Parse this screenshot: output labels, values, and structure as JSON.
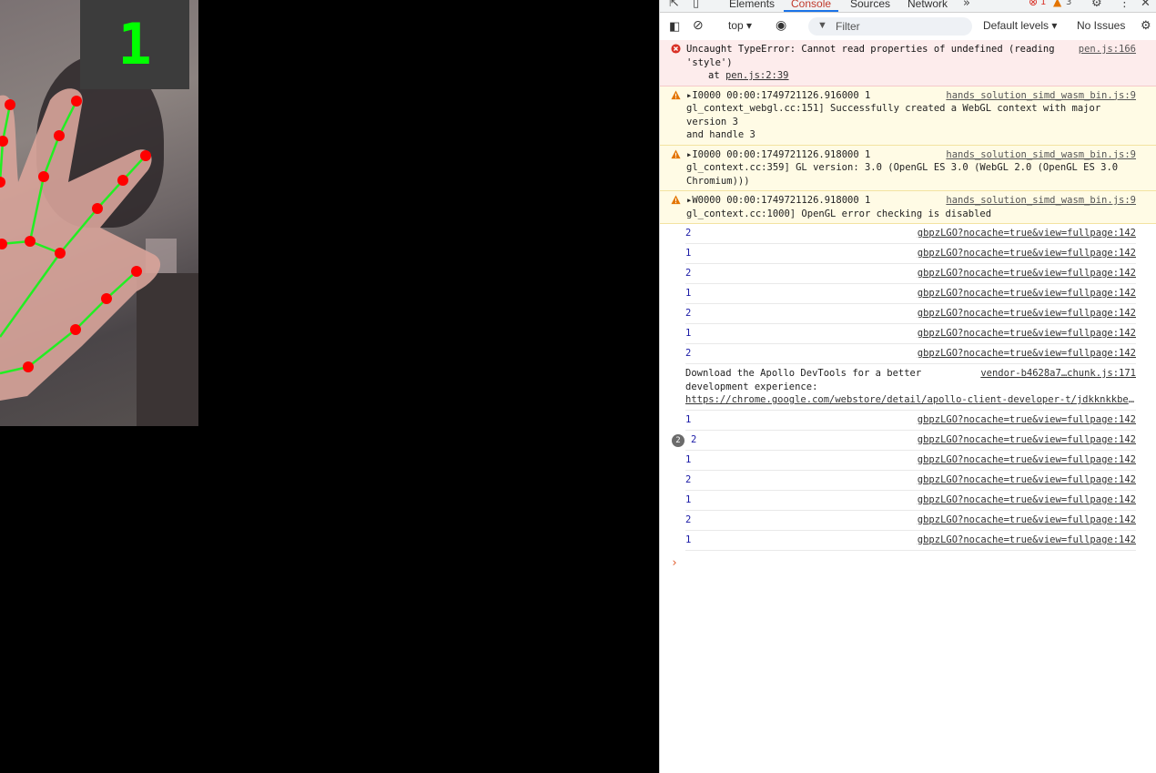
{
  "video": {
    "counter": "1"
  },
  "devtools": {
    "tabs": [
      "Elements",
      "Console",
      "Sources",
      "Network"
    ],
    "active_tab": "Console",
    "error_count": "1",
    "warning_count": "3",
    "toolbar": {
      "context": "top",
      "filter_placeholder": "Filter",
      "levels": "Default levels",
      "issues": "No Issues"
    },
    "messages": [
      {
        "kind": "error",
        "line1": "Uncaught TypeError: Cannot read properties of undefined (reading",
        "line2": "'style')",
        "line3_prefix": "at ",
        "line3_link": "pen.js:2:39",
        "source": "pen.js:166"
      },
      {
        "kind": "warning",
        "line1": "I0000 00:00:1749721126.916000        1",
        "line2": "gl_context_webgl.cc:151] Successfully created a WebGL context with major version 3",
        "line3": "and handle 3",
        "source": "hands_solution_simd_wasm_bin.js:9"
      },
      {
        "kind": "warning",
        "line1": "I0000 00:00:1749721126.918000        1",
        "line2": "gl_context.cc:359] GL version: 3.0 (OpenGL ES 3.0 (WebGL 2.0 (OpenGL ES 3.0",
        "line3": "Chromium)))",
        "source": "hands_solution_simd_wasm_bin.js:9"
      },
      {
        "kind": "warning",
        "line1": "W0000 00:00:1749721126.918000        1",
        "line2": "gl_context.cc:1000] OpenGL error checking is disabled",
        "source": "hands_solution_simd_wasm_bin.js:9"
      }
    ],
    "logs_a": [
      {
        "value": "2",
        "source": "gbpzLGO?nocache=true&view=fullpage:142"
      },
      {
        "value": "1",
        "source": "gbpzLGO?nocache=true&view=fullpage:142"
      },
      {
        "value": "2",
        "source": "gbpzLGO?nocache=true&view=fullpage:142"
      },
      {
        "value": "1",
        "source": "gbpzLGO?nocache=true&view=fullpage:142"
      },
      {
        "value": "2",
        "source": "gbpzLGO?nocache=true&view=fullpage:142"
      },
      {
        "value": "1",
        "source": "gbpzLGO?nocache=true&view=fullpage:142"
      },
      {
        "value": "2",
        "source": "gbpzLGO?nocache=true&view=fullpage:142"
      }
    ],
    "apollo": {
      "line1": "Download the Apollo DevTools for a better",
      "line2": "development experience:",
      "url": "https://chrome.google.com/webstore/detail/apollo-client-developer-t/jdkknkkbebbap…",
      "source": "vendor-b4628a7…chunk.js:171"
    },
    "logs_b": [
      {
        "value": "1",
        "source": "gbpzLGO?nocache=true&view=fullpage:142"
      },
      {
        "value": "2",
        "badge": "2",
        "source": "gbpzLGO?nocache=true&view=fullpage:142"
      },
      {
        "value": "1",
        "source": "gbpzLGO?nocache=true&view=fullpage:142"
      },
      {
        "value": "2",
        "source": "gbpzLGO?nocache=true&view=fullpage:142"
      },
      {
        "value": "1",
        "source": "gbpzLGO?nocache=true&view=fullpage:142"
      },
      {
        "value": "2",
        "source": "gbpzLGO?nocache=true&view=fullpage:142"
      },
      {
        "value": "1",
        "source": "gbpzLGO?nocache=true&view=fullpage:142"
      }
    ],
    "prompt": "›"
  }
}
